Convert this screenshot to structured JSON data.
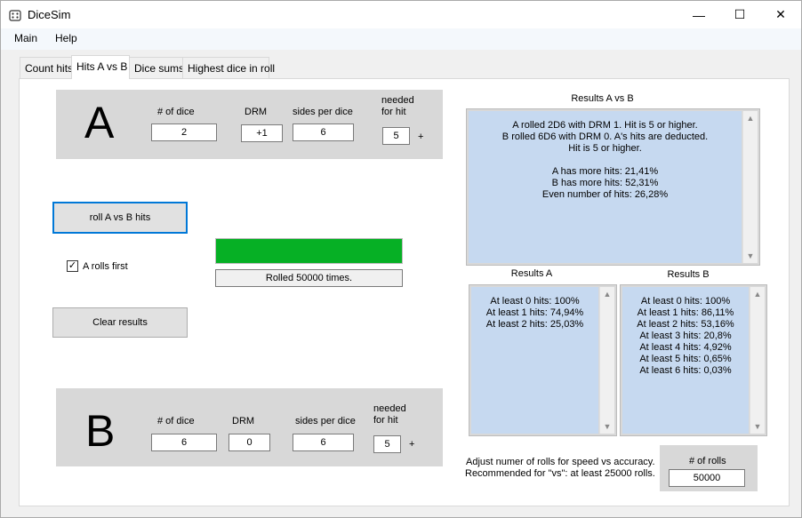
{
  "window": {
    "title": "DiceSim",
    "minimize": "—",
    "maximize": "☐",
    "close": "✕"
  },
  "menu": [
    "Main",
    "Help"
  ],
  "tabs": [
    "Count hits",
    "Hits A vs B",
    "Dice sums",
    "Highest dice in roll"
  ],
  "player_a": {
    "letter": "A",
    "dice_label": "# of dice",
    "dice_value": "2",
    "drm_label": "DRM",
    "drm_value": "+1",
    "sides_label": "sides per dice",
    "sides_value": "6",
    "needed_label_1": "needed",
    "needed_label_2": "for hit",
    "needed_value": "5",
    "plus": "+"
  },
  "player_b": {
    "letter": "B",
    "dice_label": "# of dice",
    "dice_value": "6",
    "drm_label": "DRM",
    "drm_value": "0",
    "sides_label": "sides per dice",
    "sides_value": "6",
    "needed_label_1": "needed",
    "needed_label_2": "for hit",
    "needed_value": "5",
    "plus": "+"
  },
  "controls": {
    "roll_button": "roll A vs B hits",
    "a_first_label": "A rolls first",
    "a_first_checked": "✓",
    "clear_button": "Clear results",
    "progress_fraction": 1.0,
    "status": "Rolled 50000 times."
  },
  "results_ab": {
    "title": "Results A vs B",
    "text": "A rolled 2D6 with DRM 1. Hit is 5 or higher.\nB rolled 6D6 with DRM 0. A's hits are deducted.\nHit is 5 or higher.\n\nA has more hits: 21,41%\nB has more hits: 52,31%\nEven number of hits: 26,28%"
  },
  "results_a": {
    "title": "Results A",
    "text": "At least 0 hits: 100%\nAt least 1 hits: 74,94%\nAt least 2 hits: 25,03%"
  },
  "results_b": {
    "title": "Results B",
    "text": "At least 0 hits: 100%\nAt least 1 hits: 86,11%\nAt least 2 hits: 53,16%\nAt least 3 hits: 20,8%\nAt least 4 hits: 4,92%\nAt least 5 hits: 0,65%\nAt least 6 hits: 0,03%"
  },
  "rolls": {
    "hint_line_1": "Adjust numer of rolls for speed vs accuracy.",
    "hint_line_2": "Recommended for \"vs\": at least 25000 rolls.",
    "label": "# of rolls",
    "value": "50000"
  },
  "colors": {
    "progress": "#06b025",
    "results_bg": "#c6d9f0",
    "focus": "#0078d7"
  }
}
